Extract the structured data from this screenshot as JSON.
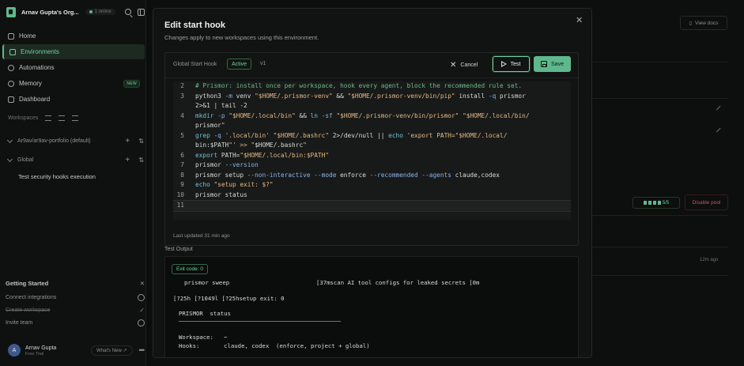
{
  "org": {
    "name": "Arnav Gupta's Org...",
    "status": "1 online"
  },
  "nav": [
    {
      "label": "Home",
      "icon": "home-icon",
      "active": false
    },
    {
      "label": "Environments",
      "icon": "terminal-icon",
      "active": true
    },
    {
      "label": "Automations",
      "icon": "automation-icon",
      "active": false
    },
    {
      "label": "Memory",
      "icon": "memory-icon",
      "active": false,
      "badge": "NEW"
    },
    {
      "label": "Dashboard",
      "icon": "dashboard-icon",
      "active": false
    }
  ],
  "workspaces": {
    "heading": "Workspaces",
    "groups": [
      {
        "label": "Ar9av/ar9av-portfolio (default)"
      },
      {
        "label": "Global"
      }
    ],
    "sub_item": "Test security hooks execution"
  },
  "getting_started": {
    "title": "Getting Started",
    "items": [
      {
        "label": "Connect integrations",
        "done": false
      },
      {
        "label": "Create workspace",
        "done": true
      },
      {
        "label": "Invite team",
        "done": false
      }
    ]
  },
  "user": {
    "initial": "A",
    "name": "Arnav Gupta",
    "plan": "Free Trial",
    "whats_new": "What's New ↗"
  },
  "background": {
    "view_docs": "View docs",
    "agents": "5/5",
    "disable_pool": "Disable pool",
    "ago": "12m ago"
  },
  "modal": {
    "title": "Edit start hook",
    "subtitle": "Changes apply to new workspaces using this environment.",
    "editor_label": "Global Start Hook",
    "status": "Active",
    "version": "v1",
    "cancel": "Cancel",
    "test": "Test",
    "save": "Save",
    "last_updated": "Last updated 31 min ago",
    "test_output_label": "Test Output",
    "exit_code": "Exit code: 0"
  },
  "code_lines": [
    {
      "n": "2",
      "t": "# Prismor: install once per workspace, hook every agent, block the recommended rule set."
    },
    {
      "n": "3",
      "t": "python3 -m venv \"$HOME/.prismor-venv\" && \"$HOME/.prismor-venv/bin/pip\" install -q prismor"
    },
    {
      "n": "",
      "t": "2>&1 | tail -2"
    },
    {
      "n": "4",
      "t": "mkdir -p \"$HOME/.local/bin\" && ln -sf \"$HOME/.prismor-venv/bin/prismor\" \"$HOME/.local/bin/"
    },
    {
      "n": "",
      "t": "prismor\""
    },
    {
      "n": "5",
      "t": "grep -q '.local/bin' \"$HOME/.bashrc\" 2>/dev/null || echo 'export PATH=\"$HOME/.local/"
    },
    {
      "n": "",
      "t": "bin:$PATH\"' >> \"$HOME/.bashrc\""
    },
    {
      "n": "6",
      "t": "export PATH=\"$HOME/.local/bin:$PATH\""
    },
    {
      "n": "7",
      "t": "prismor --version"
    },
    {
      "n": "8",
      "t": "prismor setup --non-interactive --mode enforce --recommended --agents claude,codex"
    },
    {
      "n": "9",
      "t": "echo \"setup exit: $?\""
    },
    {
      "n": "10",
      "t": "prismor status"
    },
    {
      "n": "11",
      "t": ""
    }
  ],
  "terminal_lines": [
    "prismor sweep                         [37mscan AI tool configs for leaked secrets [0m",
    "[?25h [?1049l [?25hsetup exit: 0",
    "PRISMOR  status",
    "Workspace:   ~",
    "Hooks:       claude, codex  (enforce, project + global)"
  ],
  "colors": {
    "accent": "#5fb88d",
    "danger": "#c85a5a"
  }
}
